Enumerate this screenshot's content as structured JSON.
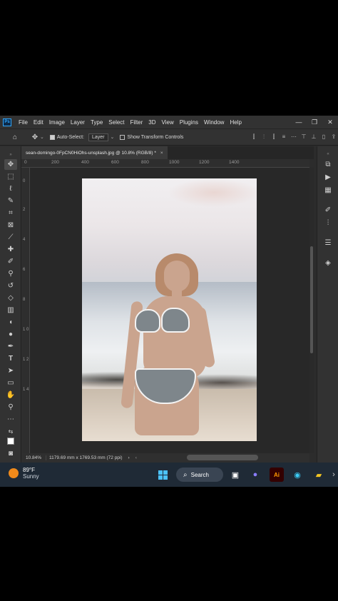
{
  "menubar": {
    "app_logo": "Ps",
    "items": [
      "File",
      "Edit",
      "Image",
      "Layer",
      "Type",
      "Select",
      "Filter",
      "3D",
      "View",
      "Plugins",
      "Window",
      "Help"
    ],
    "window_controls": [
      "—",
      "❐",
      "✕"
    ]
  },
  "options_bar": {
    "home_icon": "home-icon",
    "move_icon": "move-icon",
    "auto_select_label": "Auto-Select:",
    "auto_select_checked": true,
    "auto_select_target": "Layer",
    "show_transform_label": "Show Transform Controls",
    "show_transform_checked": false
  },
  "document": {
    "tab_title": "sean-domingo-0FpCN0HiOhs-unsplash.jpg @ 10.8% (RGB/8) *",
    "close_glyph": "×"
  },
  "rulers": {
    "top": [
      "0",
      "200",
      "400",
      "600",
      "800",
      "1000",
      "1200",
      "1400"
    ],
    "left": [
      "0",
      "2",
      "4",
      "6",
      "8",
      "1 0",
      "1 2",
      "1 4"
    ]
  },
  "status": {
    "zoom": "10.84%",
    "dimensions": "1179.69 mm x 1769.53 mm (72 ppi)",
    "arrow": "›"
  },
  "taskbar": {
    "temperature": "89°F",
    "condition": "Sunny",
    "search_label": "Search",
    "colors": {
      "bg": "#1f2a36",
      "sun": "#f08a1b"
    }
  },
  "colors": {
    "ps_bg": "#2c2c2c",
    "canvas_bg": "#282828",
    "accent": "#31a8ff"
  }
}
